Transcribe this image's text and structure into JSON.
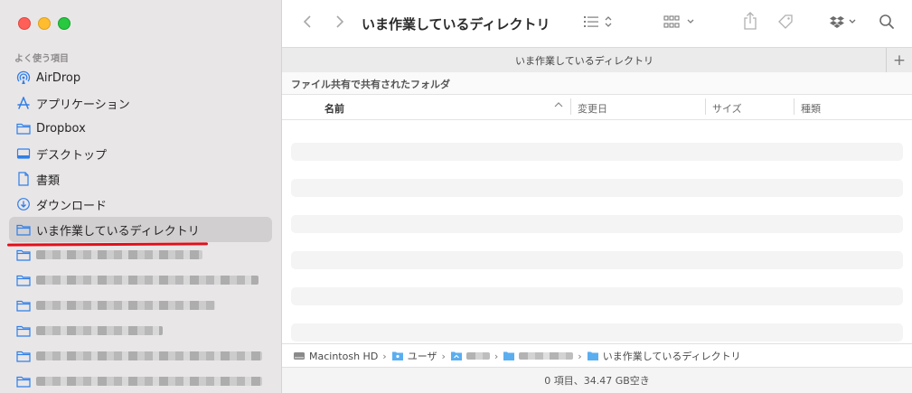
{
  "sidebar": {
    "section_label": "よく使う項目",
    "items": [
      {
        "label": "AirDrop",
        "icon": "airdrop-icon"
      },
      {
        "label": "アプリケーション",
        "icon": "applications-icon"
      },
      {
        "label": "Dropbox",
        "icon": "folder-icon"
      },
      {
        "label": "デスクトップ",
        "icon": "desktop-icon"
      },
      {
        "label": "書類",
        "icon": "document-icon"
      },
      {
        "label": "ダウンロード",
        "icon": "download-icon"
      },
      {
        "label": "いま作業しているディレクトリ",
        "icon": "folder-icon",
        "selected": true
      }
    ]
  },
  "toolbar": {
    "window_title": "いま作業しているディレクトリ"
  },
  "tab": {
    "title": "いま作業しているディレクトリ",
    "plus_label": "+"
  },
  "subheader": {
    "label": "ファイル共有で共有されたフォルダ"
  },
  "columns": {
    "name": "名前",
    "modified": "変更日",
    "size": "サイズ",
    "kind": "種類"
  },
  "pathbar": {
    "macintosh_hd": "Macintosh HD",
    "user": "ユーザ",
    "current": "いま作業しているディレクトリ"
  },
  "status": {
    "text": "0 項目、34.47 GB空き"
  },
  "colors": {
    "accent": "#2f7fe8",
    "highlight_underline": "#e0101a"
  }
}
